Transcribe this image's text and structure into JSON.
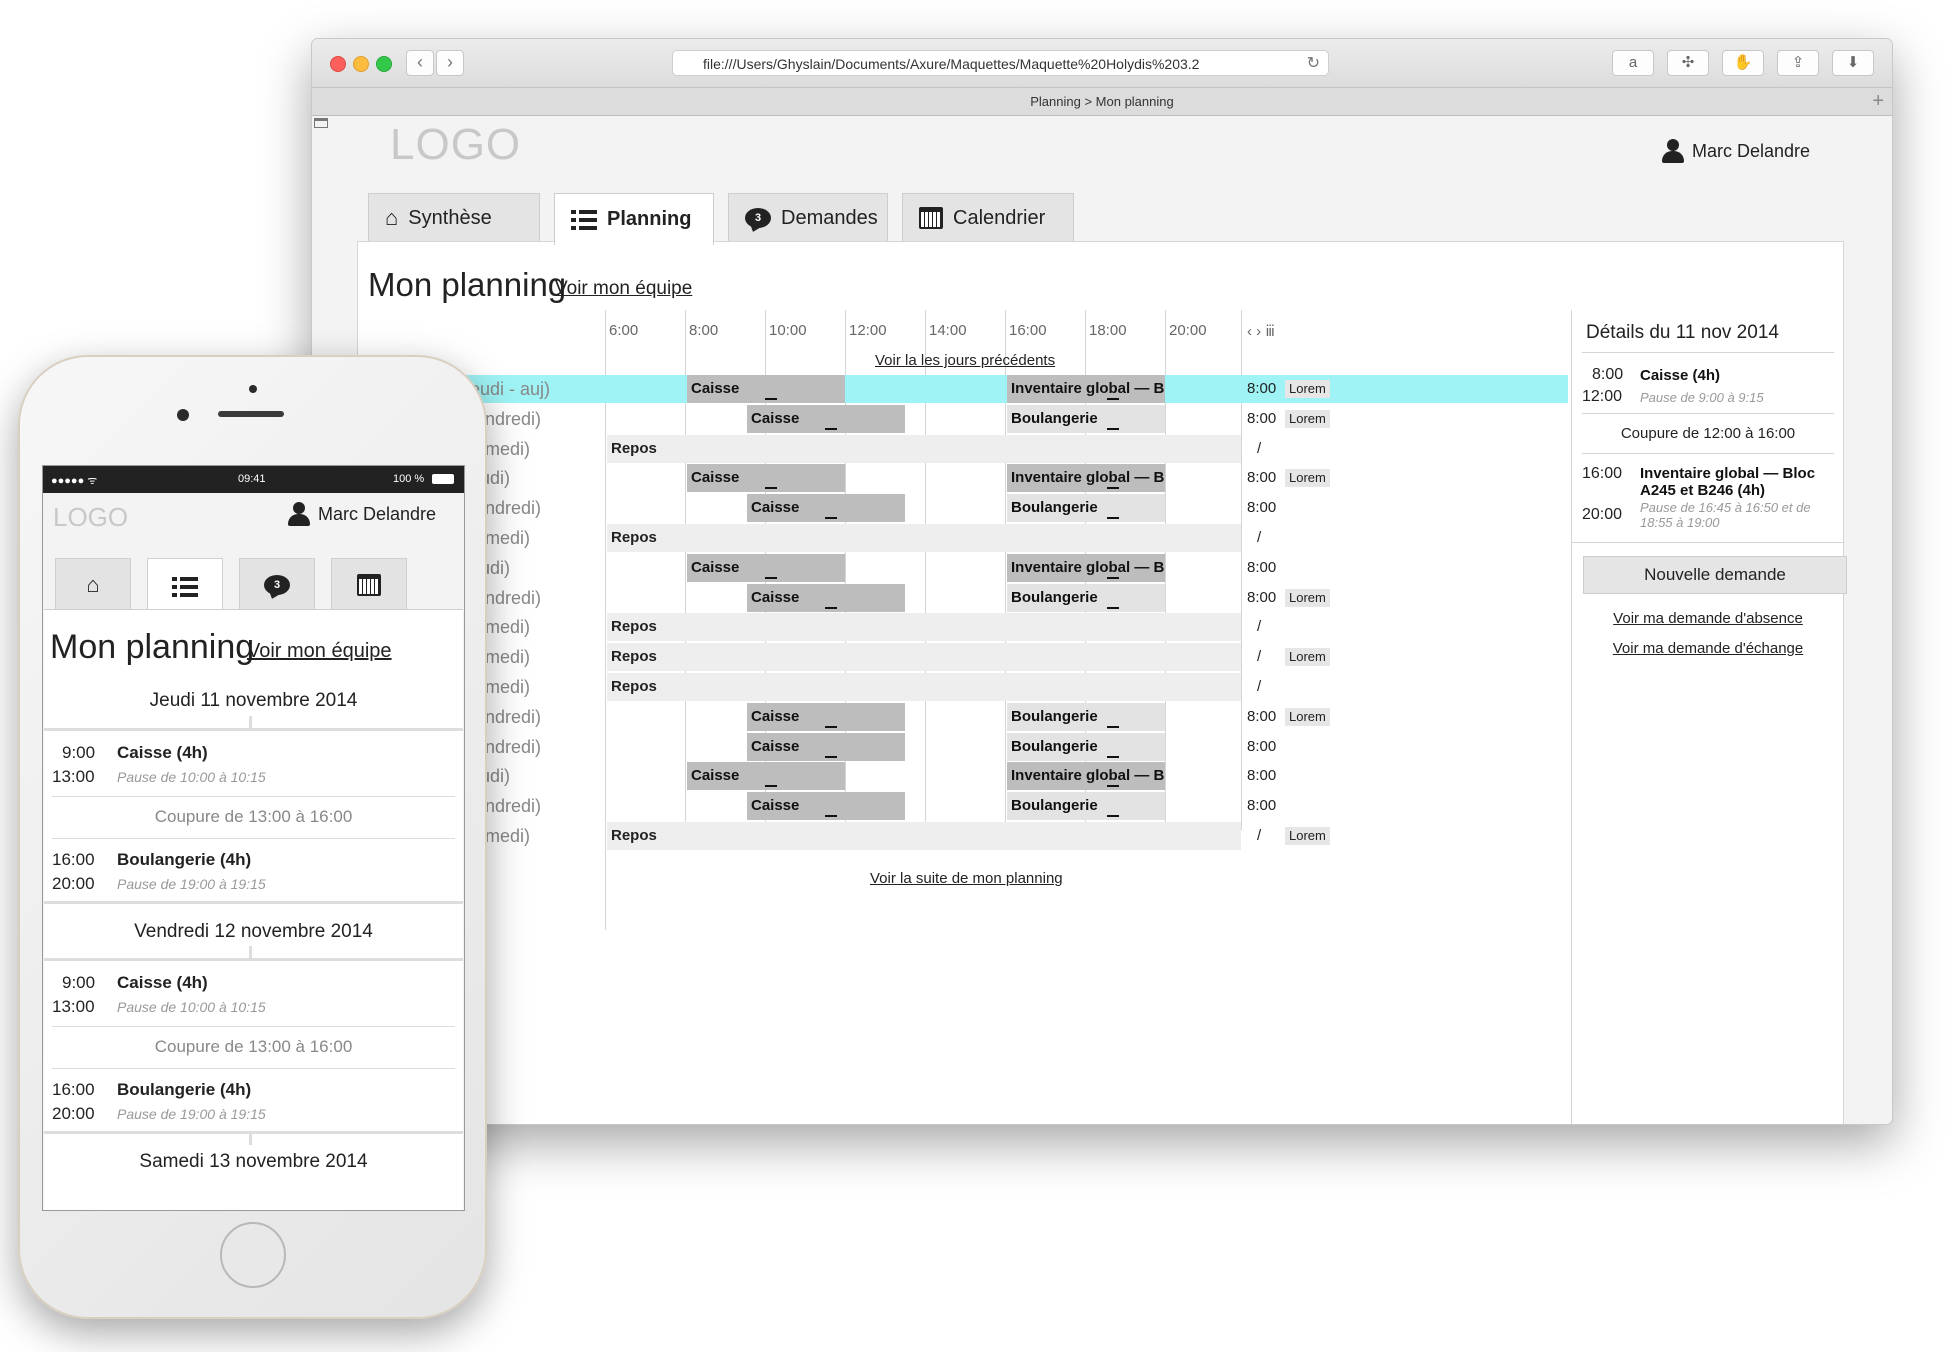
{
  "browser": {
    "url": "file:///Users/Ghyslain/Documents/Axure/Maquettes/Maquette%20Holydis%203.2",
    "tab_title": "Planning > Mon planning",
    "back_icon": "‹",
    "forward_icon": "›"
  },
  "app": {
    "logo": "LOGO",
    "user": "Marc Delandre",
    "tabs": [
      {
        "label": "Synthèse",
        "icon": "home-icon"
      },
      {
        "label": "Planning",
        "icon": "list-icon"
      },
      {
        "label": "Demandes",
        "icon": "chat-bubble-icon",
        "badge": "3"
      },
      {
        "label": "Calendrier",
        "icon": "calendar-icon"
      }
    ],
    "page_title": "Mon planning",
    "team_link": "Voir mon équipe"
  },
  "planning": {
    "hours": [
      "6:00",
      "8:00",
      "10:00",
      "12:00",
      "14:00",
      "16:00",
      "18:00",
      "20:00"
    ],
    "nav": "‹ › ⅲ",
    "prev_link": "Voir la les jours précédents",
    "next_link": "Voir la suite de mon planning",
    "rows": [
      {
        "day": "(jeudi - auj)",
        "b1": "Caisse",
        "b2": "Inventaire global — B...",
        "end": "8:00",
        "lorem": "Lorem"
      },
      {
        "day": "(vendredi)",
        "b1": "Caisse",
        "b2": "Boulangerie",
        "end": "8:00",
        "lorem": "Lorem"
      },
      {
        "day": "(samedi)",
        "repos": "Repos",
        "end": "/"
      },
      {
        "day": "(jeudi)",
        "b1": "Caisse",
        "b2": "Inventaire global — B...",
        "end": "8:00",
        "lorem": "Lorem"
      },
      {
        "day": "(vendredi)",
        "b1": "Caisse",
        "b2": "Boulangerie",
        "end": "8:00"
      },
      {
        "day": "(samedi)",
        "repos": "Repos",
        "end": "/"
      },
      {
        "day": "(jeudi)",
        "b1": "Caisse",
        "b2": "Inventaire global — B...",
        "end": "8:00"
      },
      {
        "day": "(vendredi)",
        "b1": "Caisse",
        "b2": "Boulangerie",
        "end": "8:00",
        "lorem": "Lorem"
      },
      {
        "day": "(samedi)",
        "repos": "Repos",
        "end": "/"
      },
      {
        "day": "(samedi)",
        "repos": "Repos",
        "end": "/",
        "lorem": "Lorem"
      },
      {
        "day": "(samedi)",
        "repos": "Repos",
        "end": "/"
      },
      {
        "day": "(vendredi)",
        "b1": "Caisse",
        "b2": "Boulangerie",
        "end": "8:00",
        "lorem": "Lorem"
      },
      {
        "day": "(vendredi)",
        "b1": "Caisse",
        "b2": "Boulangerie",
        "end": "8:00"
      },
      {
        "day": "(jeudi)",
        "b1": "Caisse",
        "b2": "Inventaire global — B...",
        "end": "8:00"
      },
      {
        "day": "(vendredi)",
        "b1": "Caisse",
        "b2": "Boulangerie",
        "end": "8:00"
      },
      {
        "day": "(samedi)",
        "repos": "Repos",
        "end": "/",
        "lorem": "Lorem"
      }
    ]
  },
  "details": {
    "title": "Détails du 11 nov 2014",
    "e1_start": "8:00",
    "e1_end": "12:00",
    "e1_name": "Caisse (4h)",
    "e1_pause": "Pause de 9:00 à 9:15",
    "cut": "Coupure de 12:00 à 16:00",
    "e2_start": "16:00",
    "e2_end": "20:00",
    "e2_name": "Inventaire global — Bloc A245 et B246 (4h)",
    "e2_pause": "Pause de 16:45 à 16:50 et de 18:55 à 19:00",
    "button": "Nouvelle demande",
    "link_absence": "Voir ma demande d'absence",
    "link_echange": "Voir ma demande d'échange"
  },
  "mobile": {
    "status_signal": "●●●●● ᯤ",
    "status_time": "09:41",
    "status_battery": "100 %",
    "logo": "LOGO",
    "user": "Marc Delandre",
    "badge": "3",
    "page_title": "Mon planning",
    "team_link": "Voir mon équipe",
    "day1": "Jeudi 11 novembre 2014",
    "day2": "Vendredi 12 novembre 2014",
    "day3": "Samedi 13 novembre 2014",
    "d1_e1_start": "9:00",
    "d1_e1_end": "13:00",
    "d1_e1_name": "Caisse (4h)",
    "d1_e1_pause": "Pause de 10:00 à 10:15",
    "d1_cut": "Coupure de 13:00 à 16:00",
    "d1_e2_start": "16:00",
    "d1_e2_end": "20:00",
    "d1_e2_name": "Boulangerie (4h)",
    "d1_e2_pause": "Pause de 19:00 à 19:15",
    "d2_e1_start": "9:00",
    "d2_e1_end": "13:00",
    "d2_e1_name": "Caisse (4h)",
    "d2_e1_pause": "Pause de 10:00 à 10:15",
    "d2_cut": "Coupure de 13:00 à 16:00",
    "d2_e2_start": "16:00",
    "d2_e2_end": "20:00",
    "d2_e2_name": "Boulangerie (4h)",
    "d2_e2_pause": "Pause de 19:00 à 19:15"
  },
  "colors": {
    "today_highlight": "#9ff3f5",
    "bar_dark": "#bdbdbd",
    "bar_light": "#e3e3e3"
  }
}
